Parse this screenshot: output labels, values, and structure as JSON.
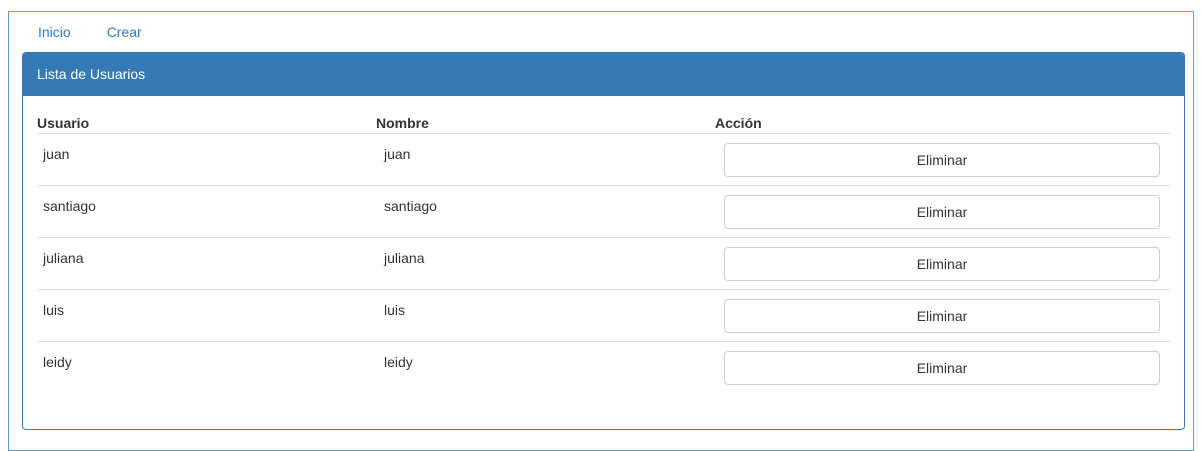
{
  "nav": {
    "items": [
      {
        "label": "Inicio"
      },
      {
        "label": "Crear"
      }
    ]
  },
  "panel": {
    "title": "Lista de Usuarios"
  },
  "table": {
    "headers": {
      "usuario": "Usuario",
      "nombre": "Nombre",
      "accion": "Acción"
    },
    "rows": [
      {
        "usuario": "juan",
        "nombre": "juan",
        "action_label": "Eliminar"
      },
      {
        "usuario": "santiago",
        "nombre": "santiago",
        "action_label": "Eliminar"
      },
      {
        "usuario": "juliana",
        "nombre": "juliana",
        "action_label": "Eliminar"
      },
      {
        "usuario": "luis",
        "nombre": "luis",
        "action_label": "Eliminar"
      },
      {
        "usuario": "leidy",
        "nombre": "leidy",
        "action_label": "Eliminar"
      }
    ]
  },
  "colors": {
    "primary": "#337ab7",
    "link": "#337ab7",
    "border": "#dddddd",
    "text": "#333333"
  }
}
